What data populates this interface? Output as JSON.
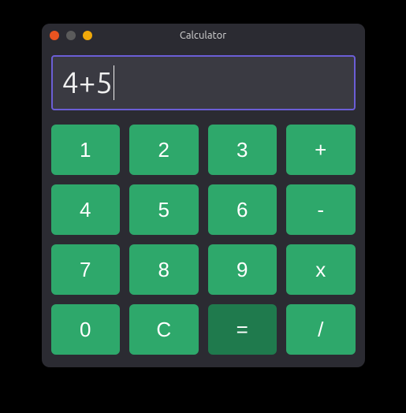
{
  "window": {
    "title": "Calculator"
  },
  "display": {
    "value": "4+5"
  },
  "buttons": {
    "r0c0": "1",
    "r0c1": "2",
    "r0c2": "3",
    "r0c3": "+",
    "r1c0": "4",
    "r1c1": "5",
    "r1c2": "6",
    "r1c3": "-",
    "r2c0": "7",
    "r2c1": "8",
    "r2c2": "9",
    "r2c3": "x",
    "r3c0": "0",
    "r3c1": "C",
    "r3c2": "=",
    "r3c3": "/"
  }
}
